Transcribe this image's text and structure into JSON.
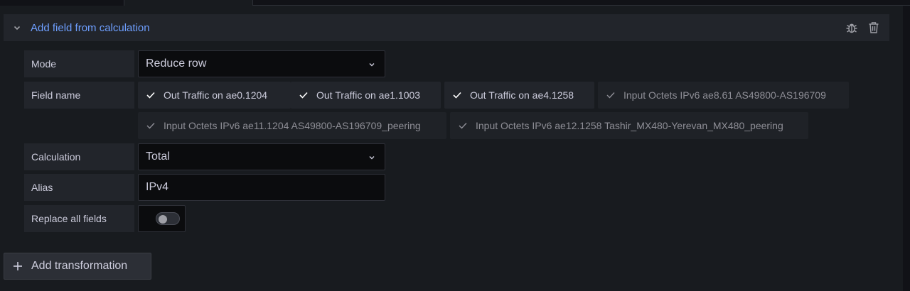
{
  "transformation": {
    "title": "Add field from calculation",
    "icons": {
      "collapse": "chevron-down-icon",
      "debug": "bug-icon",
      "delete": "trash-icon"
    }
  },
  "mode": {
    "label": "Mode",
    "value": "Reduce row"
  },
  "field_name": {
    "label": "Field name",
    "fields": [
      {
        "name": "Out Traffic on ae0.1204",
        "selected": true
      },
      {
        "name": "Out Traffic on ae1.1003",
        "selected": true
      },
      {
        "name": "Out Traffic on ae4.1258",
        "selected": true
      },
      {
        "name": "Input Octets IPv6 ae8.61 AS49800-AS196709",
        "selected": false
      },
      {
        "name": "Input Octets IPv6 ae11.1204 AS49800-AS196709_peering",
        "selected": false
      },
      {
        "name": "Input Octets IPv6 ae12.1258 Tashir_MX480-Yerevan_MX480_peering",
        "selected": false
      }
    ]
  },
  "calculation": {
    "label": "Calculation",
    "value": "Total"
  },
  "alias": {
    "label": "Alias",
    "value": "IPv4"
  },
  "replace_all": {
    "label": "Replace all fields",
    "enabled": false
  },
  "add_transformation": {
    "label": "Add transformation"
  },
  "colors": {
    "accent": "#6e9fff",
    "background": "#111217",
    "panel": "#181b1f"
  }
}
